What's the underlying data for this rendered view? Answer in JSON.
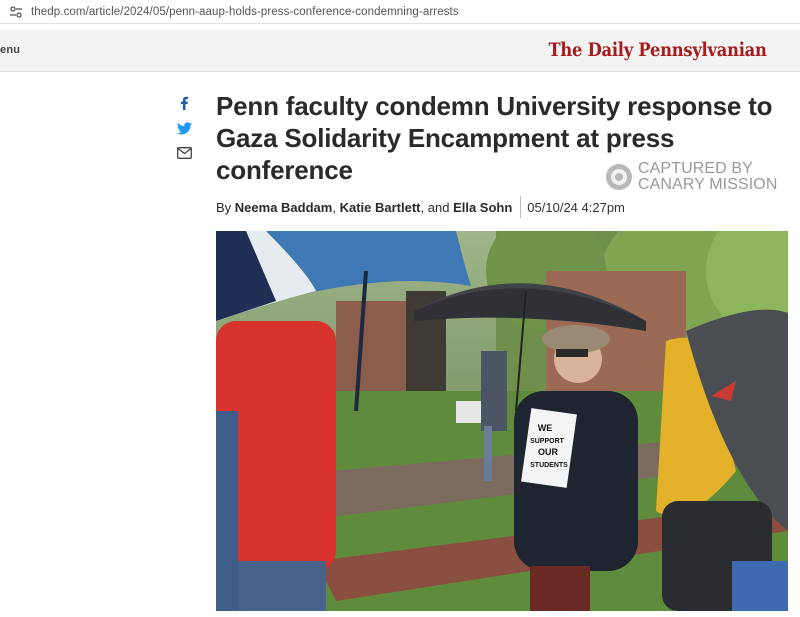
{
  "browser": {
    "url": "thedp.com/article/2024/05/penn-aaup-holds-press-conference-condemning-arrests"
  },
  "header": {
    "menu_label": "enu",
    "masthead": "The Daily Pennsylvanian"
  },
  "share": {
    "icons": [
      "facebook-icon",
      "twitter-icon",
      "mail-icon"
    ]
  },
  "article": {
    "headline_lines": [
      "Penn faculty condemn University response to",
      "Gaza Solidarity Encampment at press",
      "conference"
    ],
    "byline_prefix": "By",
    "author_1": "Neema Baddam",
    "comma_1": ",",
    "author_2": "Katie Bartlett",
    "comma_2": ", and",
    "author_3": "Ella Sohn",
    "date": "05/10/24 4:27pm",
    "photo_sign_lines": [
      "WE",
      "SUPPORT",
      "OUR",
      "STUDENTS"
    ]
  },
  "watermark": {
    "line_1": "CAPTURED BY",
    "line_2": "CANARY MISSION"
  },
  "colors": {
    "masthead_red": "#a51c1c",
    "headline": "#2a2a2a",
    "watermark_gray": "#9a9a9a",
    "share_blue": "#1d5fa6"
  }
}
